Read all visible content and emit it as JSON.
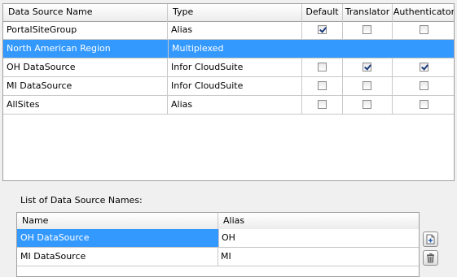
{
  "main_table": {
    "columns": [
      "Data Source Name",
      "Type",
      "Default",
      "Translator",
      "Authenticator"
    ],
    "rows": [
      {
        "name": "PortalSiteGroup",
        "type": "Alias",
        "default": true,
        "translator": false,
        "authenticator": false,
        "selected": false
      },
      {
        "name": "North American Region",
        "type": "Multiplexed",
        "default": false,
        "translator": false,
        "authenticator": false,
        "selected": true
      },
      {
        "name": "OH DataSource",
        "type": "Infor CloudSuite",
        "default": false,
        "translator": true,
        "authenticator": true,
        "selected": false
      },
      {
        "name": "MI DataSource",
        "type": "Infor CloudSuite",
        "default": false,
        "translator": false,
        "authenticator": false,
        "selected": false
      },
      {
        "name": "AllSites",
        "type": "Alias",
        "default": false,
        "translator": false,
        "authenticator": false,
        "selected": false
      }
    ]
  },
  "alias_section": {
    "label": "List of Data Source Names:",
    "columns": [
      "Name",
      "Alias"
    ],
    "rows": [
      {
        "name": "OH DataSource",
        "alias": "OH",
        "selected": true
      },
      {
        "name": "MI DataSource",
        "alias": "MI",
        "selected": false
      }
    ]
  },
  "icons": {
    "add": "add-row-icon",
    "delete": "trash-icon"
  },
  "colors": {
    "selection": "#3399ff",
    "grid_line": "#c8c8c8"
  }
}
